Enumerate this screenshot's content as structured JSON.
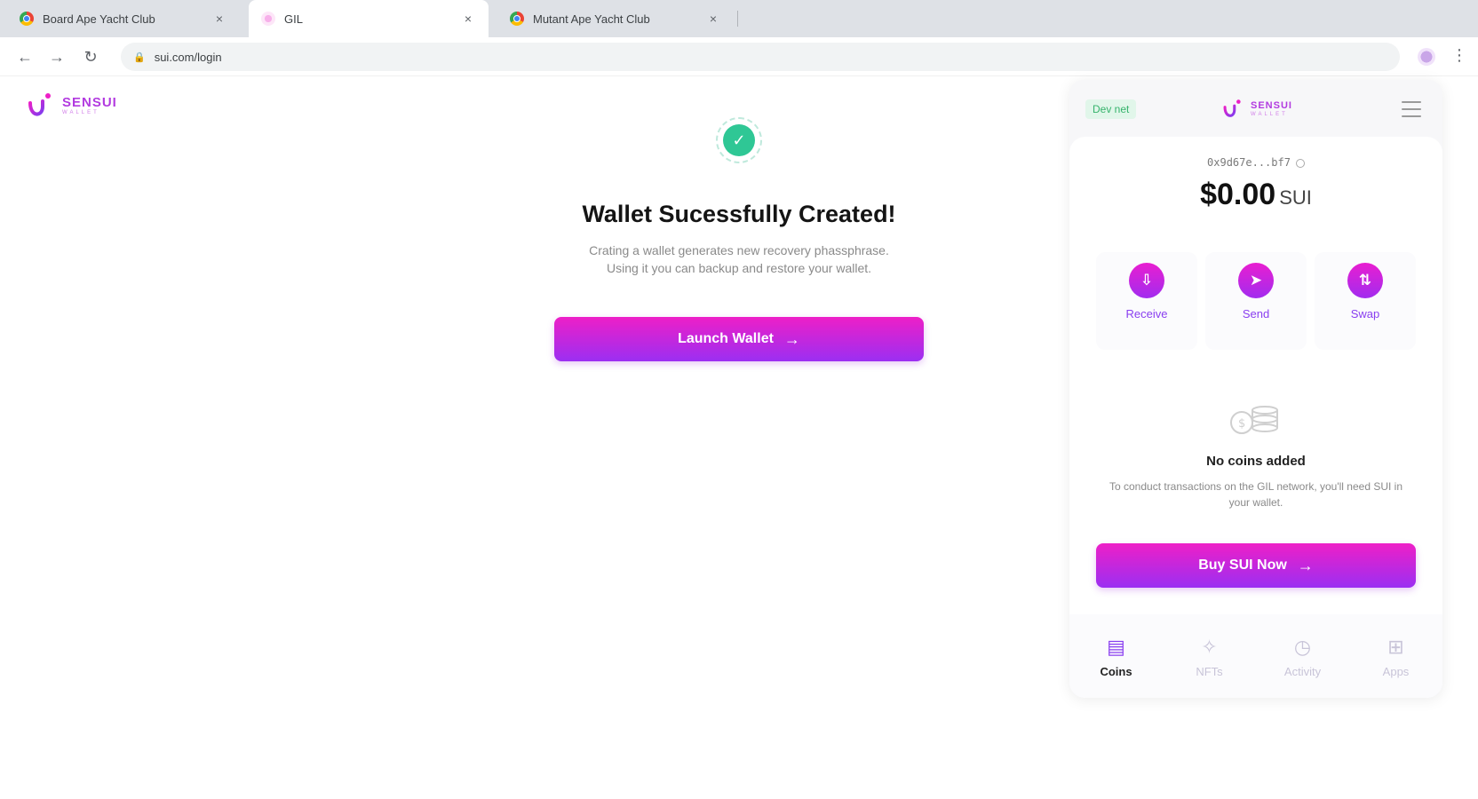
{
  "browser": {
    "tabs": [
      {
        "title": "Board Ape Yacht Club",
        "close": "×"
      },
      {
        "title": "GIL",
        "close": "×"
      },
      {
        "title": "Mutant Ape Yacht Club",
        "close": "×"
      }
    ],
    "url": "sui.com/login",
    "nav": {
      "back": "←",
      "forward": "→",
      "reload": "↻",
      "lock": "🔒",
      "menu": "⋮"
    }
  },
  "brand": {
    "name": "SENSUI",
    "tagline": "WALLET",
    "accent": "#b23be0"
  },
  "main": {
    "check_glyph": "✓",
    "title": "Wallet Sucessfully Created!",
    "description_line1": "Crating a wallet generates new recovery phassphrase.",
    "description_line2": "Using it you can backup and restore your wallet.",
    "launch_label": "Launch Wallet",
    "arrow": "→"
  },
  "wallet": {
    "network": "Dev net",
    "address": "0x9d67e...bf7",
    "balance": "$0.00",
    "currency": "SUI",
    "actions": [
      {
        "label": "Receive",
        "icon": "receive-icon",
        "glyph": "⇩"
      },
      {
        "label": "Send",
        "icon": "send-icon",
        "glyph": "➤"
      },
      {
        "label": "Swap",
        "icon": "swap-icon",
        "glyph": "⇅"
      }
    ],
    "empty_title": "No coins added",
    "empty_desc": "To conduct transactions on the GIL network, you'll need SUI in your wallet.",
    "buy_label": "Buy SUI Now",
    "bottom_nav": [
      {
        "label": "Coins",
        "icon": "coins-icon",
        "glyph": "▤",
        "active": true
      },
      {
        "label": "NFTs",
        "icon": "nfts-icon",
        "glyph": "✧",
        "active": false
      },
      {
        "label": "Activity",
        "icon": "activity-icon",
        "glyph": "◷",
        "active": false
      },
      {
        "label": "Apps",
        "icon": "apps-icon",
        "glyph": "⊞",
        "active": false
      }
    ]
  },
  "colors": {
    "gradient_start": "#ee1fc7",
    "gradient_end": "#9b2ff2",
    "success": "#2fc795",
    "net_badge": "#36b36c"
  }
}
